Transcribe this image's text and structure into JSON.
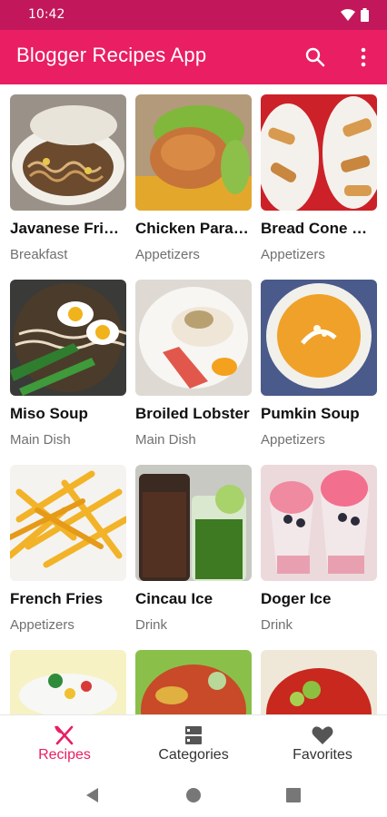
{
  "status_bar": {
    "time": "10:42"
  },
  "app_bar": {
    "title": "Blogger Recipes App",
    "search_icon": "search-icon",
    "more_icon": "more-vert-icon"
  },
  "recipes": [
    {
      "title": "Javanese Fried Noodles",
      "display_title": "Javanese Fri…",
      "category": "Breakfast"
    },
    {
      "title": "Chicken Parade",
      "display_title": "Chicken Para…",
      "category": "Appetizers"
    },
    {
      "title": "Bread Cone …",
      "display_title": "Bread Cone …",
      "category": "Appetizers"
    },
    {
      "title": "Miso Soup",
      "display_title": "Miso Soup",
      "category": "Main Dish"
    },
    {
      "title": "Broiled Lobster",
      "display_title": "Broiled Lobster",
      "category": "Main Dish"
    },
    {
      "title": "Pumkin Soup",
      "display_title": "Pumkin Soup",
      "category": "Appetizers"
    },
    {
      "title": "French Fries",
      "display_title": "French Fries",
      "category": "Appetizers"
    },
    {
      "title": "Cincau Ice",
      "display_title": "Cincau Ice",
      "category": "Drink"
    },
    {
      "title": "Doger Ice",
      "display_title": "Doger Ice",
      "category": "Drink"
    }
  ],
  "bottom_nav": [
    {
      "label": "Recipes",
      "icon": "utensils-icon",
      "active": true
    },
    {
      "label": "Categories",
      "icon": "categories-icon",
      "active": false
    },
    {
      "label": "Favorites",
      "icon": "heart-icon",
      "active": false
    }
  ],
  "colors": {
    "primary": "#e91e63",
    "primary_dark": "#c2185b"
  }
}
